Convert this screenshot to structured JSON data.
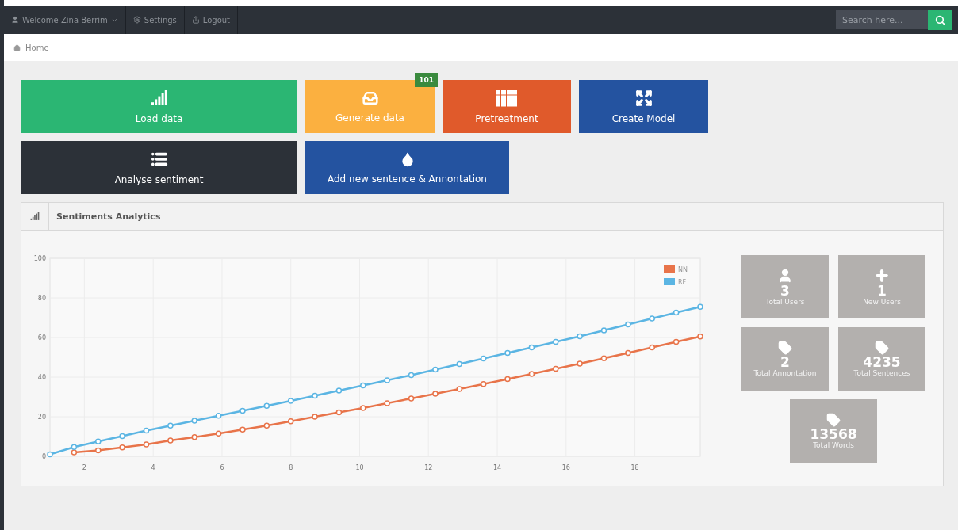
{
  "navbar": {
    "items": [
      {
        "kind": "dropdown",
        "label": "Welcome Zina Berrim"
      },
      {
        "kind": "settings",
        "label": "Settings"
      },
      {
        "kind": "logout",
        "label": "Logout"
      }
    ],
    "search": {
      "placeholder": "Search here..."
    }
  },
  "breadcrumb": {
    "items": [
      {
        "label": "Home"
      }
    ]
  },
  "tile_rows": [
    [
      {
        "label": "Load data",
        "color": "#2bb673"
      },
      {
        "label": "Generate data",
        "color": "#fbb040",
        "badge": "101"
      },
      {
        "label": "Pretreatment",
        "color": "#e05a2b"
      },
      {
        "label": "Create Model",
        "color": "#2453a0"
      }
    ],
    [
      {
        "label": "Analyse sentiment",
        "color": "#2c3138"
      },
      {
        "label": "Add new sentence & Annontation",
        "color": "#2453a0"
      }
    ]
  ],
  "panel": {
    "title": "Sentiments Analytics",
    "chart_data": {
      "type": "line",
      "x": [
        1,
        1.7,
        2.4,
        3.1,
        3.8,
        4.5,
        5.2,
        5.9,
        6.6,
        7.3,
        8,
        8.7,
        9.4,
        10.1,
        10.8,
        11.5,
        12.2,
        12.9,
        13.6,
        14.3,
        15,
        15.7,
        16.4,
        17.1,
        17.8,
        18.5,
        19.2,
        19.9
      ],
      "xlim": [
        1,
        19.9
      ],
      "ylim": [
        0,
        100
      ],
      "xticks": [
        2,
        4,
        6,
        8,
        10,
        12,
        14,
        16,
        18
      ],
      "yticks": [
        0,
        20,
        40,
        60,
        80,
        100
      ],
      "grid": true,
      "legend": true,
      "series": [
        {
          "name": "NN",
          "color": "#e8744a",
          "marker": "circle",
          "values": [
            null,
            2,
            3,
            4.5,
            6,
            8,
            9.7,
            11.5,
            13.5,
            15.5,
            17.7,
            20,
            22.2,
            24.4,
            26.8,
            29.2,
            31.6,
            34,
            36.5,
            39,
            41.6,
            44.2,
            46.8,
            49.5,
            52.2,
            55,
            57.8,
            60.5
          ]
        },
        {
          "name": "RF",
          "color": "#5bb5e3",
          "marker": "circle",
          "values": [
            1,
            4.7,
            7.5,
            10.2,
            13,
            15.5,
            18,
            20.5,
            23,
            25.5,
            28,
            30.6,
            33.2,
            35.8,
            38.4,
            41,
            43.8,
            46.6,
            49.4,
            52.2,
            55,
            57.8,
            60.6,
            63.6,
            66.6,
            69.6,
            72.6,
            75.5
          ]
        }
      ]
    },
    "stats": [
      {
        "kind": "user",
        "value": "3",
        "label": "Total Users"
      },
      {
        "kind": "plus",
        "value": "1",
        "label": "New Users"
      },
      {
        "kind": "tag",
        "value": "2",
        "label": "Total Annontation"
      },
      {
        "kind": "tag",
        "value": "4235",
        "label": "Total Sentences"
      },
      {
        "kind": "tag",
        "value": "13568",
        "label": "Total Words"
      }
    ]
  }
}
